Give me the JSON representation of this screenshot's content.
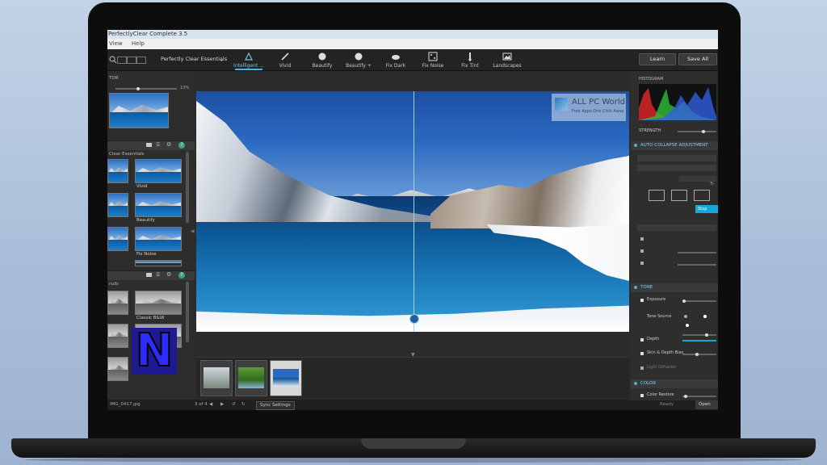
{
  "app": {
    "title": "PerfectlyClear Complete 3.5",
    "menu": [
      "View",
      "Help"
    ]
  },
  "toolbar": {
    "preset_name": "Perfectly Clear Essentials",
    "tools": [
      {
        "label": "Intelligent ...",
        "icon": "intelligent-auto-icon",
        "active": true
      },
      {
        "label": "Vivid",
        "icon": "brush-icon"
      },
      {
        "label": "Beautify",
        "icon": "beautify-icon"
      },
      {
        "label": "Beautify +",
        "icon": "beautify-plus-icon"
      },
      {
        "label": "Fix Dark",
        "icon": "fix-dark-icon"
      },
      {
        "label": "Fix Noise",
        "icon": "fix-noise-icon"
      },
      {
        "label": "Fix Tint",
        "icon": "fix-tint-icon"
      },
      {
        "label": "Landscapes",
        "icon": "landscape-icon"
      }
    ],
    "learn_label": "Learn",
    "save_all_label": "Save All"
  },
  "left_panel": {
    "navigator_title": "TOR",
    "zoom_value": "13%",
    "presets_group": "Clear Essentials",
    "preset_labels": [
      "Vivid",
      "Beautify",
      "Fix Noise"
    ],
    "bw_group": "nulls",
    "bw_labels": [
      "Classic B&W"
    ]
  },
  "watermark": {
    "title": "ALL PC World",
    "sub": "Free Apps One Click Away"
  },
  "filmstrip": {
    "page": "3 of 4",
    "sync_label": "Sync Settings",
    "filename": "IMG_0417.jpg"
  },
  "right_panel": {
    "histogram_title": "HISTOGRAM",
    "strength_label": "STRENGTH",
    "auto_collapse": "AUTO COLLAPSE ADJUSTMENT",
    "sections": {
      "tone": "TONE",
      "color": "COLOR"
    },
    "tone_items": [
      "Exposure",
      "Tone Source",
      "Depth",
      "Skin & Depth Bias",
      "Light Diffusion"
    ],
    "color_items": [
      "Color Restore"
    ],
    "stop_label": "Stop Correction",
    "open_label": "Open Adjust",
    "status": "Ready"
  },
  "colors": {
    "accent": "#4db0dd",
    "panel": "#2d2d2d",
    "toolbar": "#232323"
  }
}
